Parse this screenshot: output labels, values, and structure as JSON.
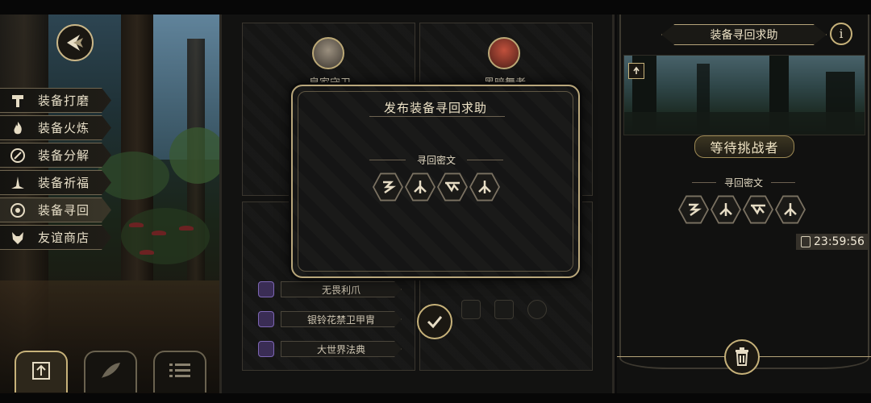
{
  "sidebar": {
    "items": [
      {
        "label": "装备打磨",
        "icon": "hammer-icon"
      },
      {
        "label": "装备火炼",
        "icon": "flame-icon"
      },
      {
        "label": "装备分解",
        "icon": "decompose-icon"
      },
      {
        "label": "装备祈福",
        "icon": "blessing-icon"
      },
      {
        "label": "装备寻回",
        "icon": "retrieve-icon"
      },
      {
        "label": "友谊商店",
        "icon": "fox-icon"
      }
    ],
    "active_index": 4
  },
  "board": {
    "card_left_name": "皇家守卫",
    "card_right_name": "黑暗舞者",
    "equipment": [
      {
        "label": "无畏利爪"
      },
      {
        "label": "银铃花禁卫甲胄"
      },
      {
        "label": "大世界法典"
      }
    ]
  },
  "modal": {
    "title": "发布装备寻回求助",
    "code_label": "寻回密文",
    "runes": [
      "rune-a-icon",
      "rune-b-icon",
      "rune-c-icon",
      "rune-b-icon"
    ]
  },
  "right_panel": {
    "title": "装备寻回求助",
    "info_label": "i",
    "status": "等待挑战者",
    "code_label": "寻回密文",
    "timer": "23:59:56"
  },
  "colors": {
    "gold_border": "#c7b27a",
    "panel_bg": "#151514",
    "text": "#e6dcc4"
  }
}
